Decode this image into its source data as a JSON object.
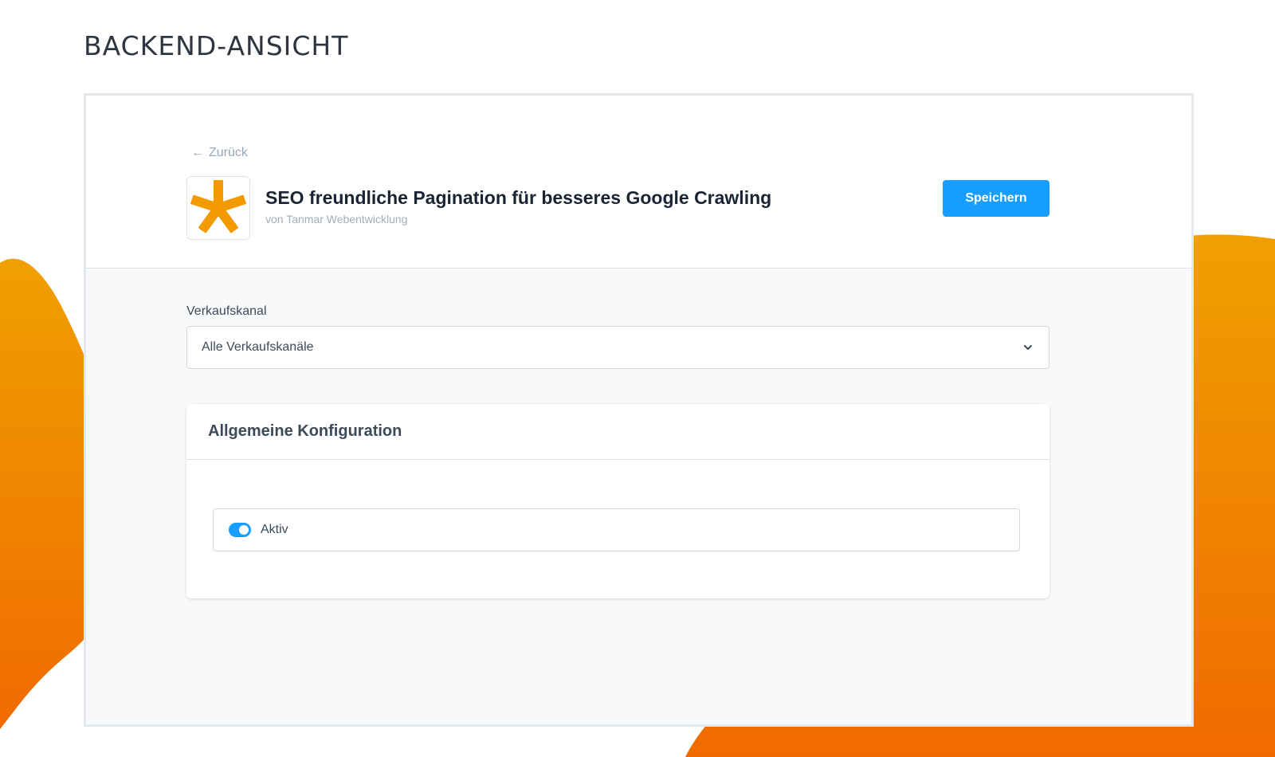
{
  "page": {
    "heading": "BACKEND-ANSICHT"
  },
  "colors": {
    "accent": "#189eff",
    "blob_orange_top": "#f0a000",
    "blob_orange_bottom": "#f06a00",
    "logo_orange": "#f39a00"
  },
  "header": {
    "back_label": "Zurück",
    "back_icon": "arrow-left-icon",
    "plugin_logo_icon": "asterisk-logo",
    "plugin_title": "SEO freundliche Pagination für besseres Google Crawling",
    "plugin_author": "von Tanmar Webentwicklung",
    "save_label": "Speichern"
  },
  "sales_channel": {
    "label": "Verkaufskanal",
    "selected": "Alle Verkaufskanäle",
    "icon": "chevron-down-icon"
  },
  "config_card": {
    "title": "Allgemeine Konfiguration",
    "toggle_label": "Aktiv",
    "toggle_on": true
  }
}
